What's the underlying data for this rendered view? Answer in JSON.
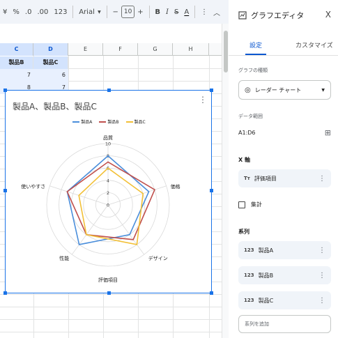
{
  "toolbar": {
    "currency": "¥",
    "percent": "%",
    "dec_decrease": ".0",
    "dec_increase": ".00",
    "format_number": "123",
    "font": "Arial",
    "minus": "−",
    "size": "10",
    "plus": "+",
    "bold": "B",
    "italic": "I",
    "strike": "S",
    "text_color": "A",
    "more": "⋮",
    "collapse": "︿"
  },
  "grid": {
    "columns": [
      "C",
      "D",
      "E",
      "F",
      "G",
      "H"
    ],
    "header_cells": [
      "製品B",
      "製品C"
    ],
    "rows": [
      [
        "7",
        "6"
      ],
      [
        "8",
        "7"
      ]
    ]
  },
  "chart": {
    "title": "製品A、製品B、製品C",
    "menu": "⋮",
    "colors": {
      "製品A": "#4a8edb",
      "製品B": "#c0504d",
      "製品C": "#f2c037"
    }
  },
  "chart_data": {
    "type": "radar",
    "title": "製品A、製品B、製品C",
    "xlabel": "評価項目",
    "categories": [
      "品質",
      "価格",
      "デザイン",
      "性能",
      "使いやすさ"
    ],
    "ticks": [
      "0",
      "2",
      "4",
      "6",
      "8",
      "10"
    ],
    "rmax": 10,
    "series": [
      {
        "name": "製品A",
        "values": [
          8,
          7,
          6,
          8,
          7
        ]
      },
      {
        "name": "製品B",
        "values": [
          7,
          8,
          7,
          6,
          7
        ]
      },
      {
        "name": "製品C",
        "values": [
          6,
          6,
          8,
          6,
          5
        ]
      }
    ],
    "legend": "top"
  },
  "panel": {
    "title": "グラフエディタ",
    "close": "X",
    "tab_setup": "設定",
    "tab_customize": "カスタマイズ",
    "chart_type_label": "グラフの種類",
    "chart_type": "レーダー チャート",
    "range_label": "データ範囲",
    "range": "A1:D6",
    "x_axis_label": "X 軸",
    "x_axis_chip": "評価項目",
    "aggregate": "集計",
    "series_label": "系列",
    "series": [
      "製品A",
      "製品B",
      "製品C"
    ],
    "add_series": "系列を追加",
    "num_icon": "123",
    "tt_icon": "Tт"
  }
}
